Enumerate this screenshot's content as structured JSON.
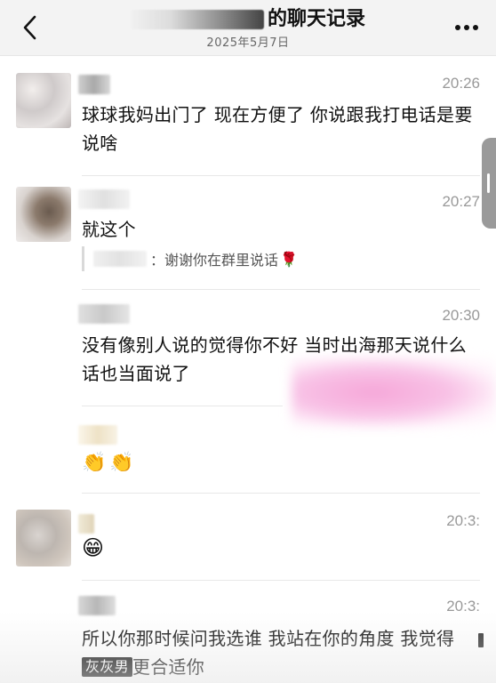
{
  "header": {
    "title_suffix": "的聊天记录",
    "date": "2025年5月7日"
  },
  "messages": [
    {
      "time": "20:26",
      "text": "球球我妈出门了 现在方便了 你说跟我打电话是要说啥"
    },
    {
      "time": "20:27",
      "text": "就这个",
      "quote": {
        "text": "：谢谢你在群里说话",
        "emoji": "🌹"
      }
    },
    {
      "time": "20:30",
      "text": "没有像别人说的觉得你不好 当时出海那天说什么话也当面说了"
    },
    {
      "emoji": [
        "👏",
        "👏"
      ]
    },
    {
      "time": "20:3:",
      "emoji": [
        "😁"
      ]
    },
    {
      "time": "20:3:",
      "text_before": "所以你那时候问我选谁 我站在你的角度 我觉得",
      "tag": "灰灰男",
      "text_after": "更合适你"
    }
  ]
}
